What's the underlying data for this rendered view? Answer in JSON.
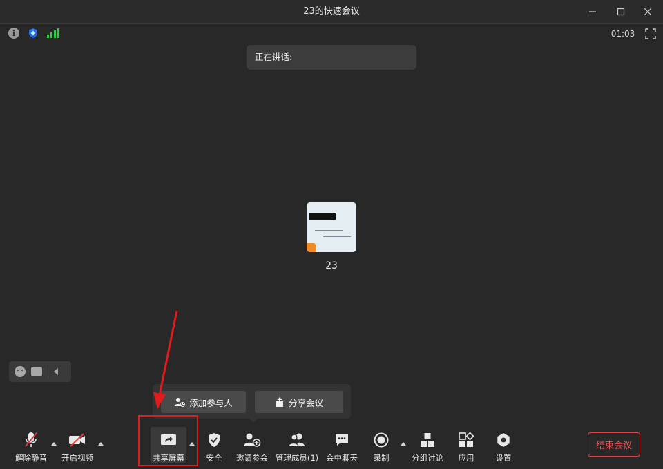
{
  "window": {
    "title": "23的快速会议"
  },
  "status": {
    "timer": "01:03"
  },
  "speaker": {
    "label": "正在讲话:"
  },
  "participant": {
    "name": "23"
  },
  "invite_popup": {
    "add_participant": "添加参与人",
    "share_meeting": "分享会议"
  },
  "toolbar": {
    "mute": "解除静音",
    "video": "开启视频",
    "share_screen": "共享屏幕",
    "security": "安全",
    "invite": "邀请参会",
    "manage_members": "管理成员(1)",
    "chat": "会中聊天",
    "record": "录制",
    "breakout": "分组讨论",
    "apps": "应用",
    "settings": "设置",
    "end_meeting": "结束会议"
  },
  "colors": {
    "background": "#282828",
    "highlight": "#e21c1c",
    "end_button": "#e24545",
    "signal": "#2ecc40",
    "shield": "#1e6ff0"
  }
}
